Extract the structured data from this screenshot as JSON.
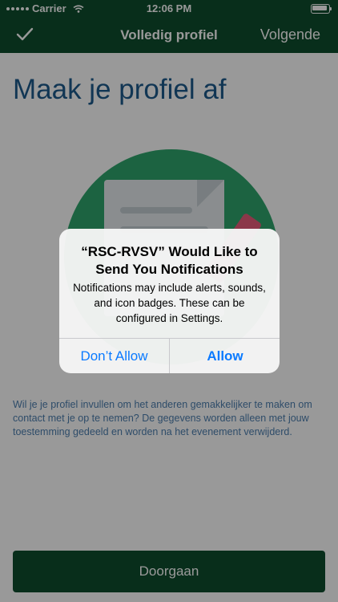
{
  "status_bar": {
    "carrier": "Carrier",
    "time": "12:06 PM"
  },
  "nav": {
    "title": "Volledig profiel",
    "next_label": "Volgende",
    "check_icon": "checkmark-icon"
  },
  "page": {
    "title": "Maak je profiel af",
    "description": "Wil je je profiel invullen om het anderen gemakkelijker te maken om contact met je op te nemen? De gegevens worden alleen met jouw toestemming gedeeld en worden na het evenement verwijderd.",
    "continue_label": "Doorgaan",
    "illustration_icon": "profile-document-icon"
  },
  "alert": {
    "title": "“RSC-RVSV” Would Like to Send You Notifications",
    "message": "Notifications may include alerts, sounds, and icon badges. These can be configured in Settings.",
    "deny_label": "Don’t Allow",
    "allow_label": "Allow"
  },
  "colors": {
    "brand_green": "#0e4d2e",
    "title_blue": "#1d5a8c",
    "illustration_green": "#2fa66d",
    "ios_blue": "#0a7aff"
  }
}
